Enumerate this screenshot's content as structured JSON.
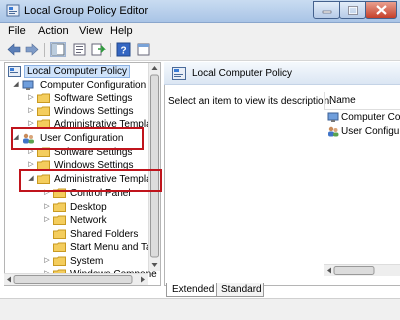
{
  "window": {
    "title": "Local Group Policy Editor",
    "buttons": [
      "minimize",
      "maximize",
      "close"
    ]
  },
  "menu": {
    "items": [
      "File",
      "Action",
      "View",
      "Help"
    ]
  },
  "toolbar": {
    "icons": [
      "back-arrow-icon",
      "forward-arrow-icon",
      "show-hide-tree-icon",
      "properties-icon",
      "export-list-icon",
      "help-icon",
      "extended-view-icon"
    ]
  },
  "tree": {
    "root": "Local Computer Policy",
    "computer_config": "Computer Configuration",
    "cc_children": [
      "Software Settings",
      "Windows Settings",
      "Administrative Templa"
    ],
    "user_config": "User Configuration",
    "uc_children": [
      "Software Settings",
      "Windows Settings",
      "Administrative Templat"
    ],
    "admin_children": [
      "Control Panel",
      "Desktop",
      "Network",
      "Shared Folders",
      "Start Menu and Tas",
      "System",
      "Windows Compone"
    ]
  },
  "right": {
    "header": "Local Computer Policy",
    "description": "Select an item to view its description.",
    "column": "Name",
    "items": [
      "Computer Co",
      "User Configu"
    ]
  },
  "tabs": [
    "Extended",
    "Standard"
  ],
  "colors": {
    "highlight": "#c0141c",
    "selection": "#cfe3fb",
    "titlebar": "#b9d1ee"
  }
}
